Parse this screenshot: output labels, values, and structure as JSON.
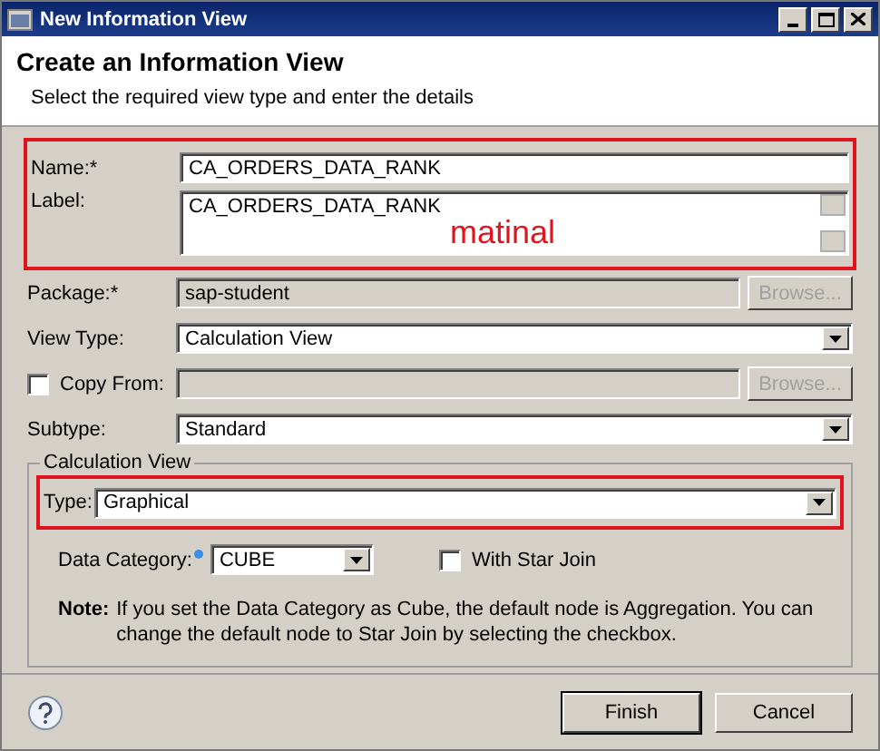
{
  "window": {
    "title": "New Information View"
  },
  "header": {
    "title": "Create an Information View",
    "description": "Select the required view type and enter the details"
  },
  "fields": [
    {
      "kind": "text",
      "label": "Name:*",
      "value": "CA_ORDERS_DATA_RANK",
      "highlighted": true
    },
    {
      "kind": "textarea",
      "label": "Label:",
      "value": "CA_ORDERS_DATA_RANK",
      "highlighted": true,
      "annotation": "matinal"
    },
    {
      "kind": "text",
      "label": "Package:*",
      "value": "sap-student",
      "disabled": true,
      "button": "Browse...",
      "highlighted": false
    },
    {
      "kind": "dropdown",
      "label": "View Type:",
      "value": "Calculation View",
      "highlighted": false
    },
    {
      "kind": "checkbox",
      "label": "Copy From:",
      "checked": false,
      "disabled": true,
      "button": "Browse...",
      "highlighted": false
    },
    {
      "kind": "dropdown",
      "label": "Subtype:",
      "value": "Standard",
      "highlighted": false
    }
  ],
  "group": {
    "title": "Calculation View",
    "type_field": {
      "label": "Type:",
      "value": "Graphical",
      "highlighted": true
    },
    "data_category": {
      "label": "Data Category:",
      "value": "CUBE"
    },
    "star_join": {
      "label": "With Star Join",
      "checked": false
    },
    "note": {
      "label": "Note:",
      "text": "If you set the Data Category as Cube, the default node is Aggregation. You can change the default node to Star Join by selecting the checkbox."
    }
  },
  "buttons": [
    {
      "label": "Finish",
      "default": true
    },
    {
      "label": "Cancel",
      "default": false
    }
  ]
}
